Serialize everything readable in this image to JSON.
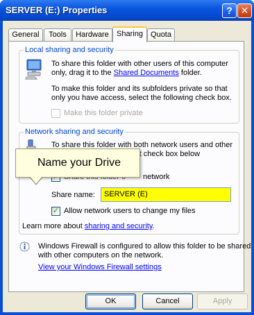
{
  "window": {
    "title": "SERVER (E:) Properties",
    "help_glyph": "?",
    "close_glyph": "✕"
  },
  "tabs": [
    {
      "label": "General"
    },
    {
      "label": "Tools"
    },
    {
      "label": "Hardware"
    },
    {
      "label": "Sharing",
      "active": true
    },
    {
      "label": "Quota"
    }
  ],
  "local_sharing": {
    "legend": "Local sharing and security",
    "line1": "To share this folder with other users of this computer",
    "line2_prefix": "only, drag it to the ",
    "shared_documents_link": "Shared Documents",
    "line2_suffix": " folder.",
    "line3": "To make this folder and its subfolders private so that",
    "line4": "only you have access, select the following check box.",
    "make_private_label": "Make this folder private",
    "make_private_checked": false,
    "make_private_enabled": false
  },
  "network_sharing": {
    "legend": "Network sharing and security",
    "line1": "To share this folder with both network users and other",
    "line2": "ct the first check box below",
    "share_checkbox_label": "network",
    "share_checkbox_label_partial": "Share this folder o",
    "share_checked": true,
    "share_name_label": "Share name:",
    "share_name_value": "SERVER (E)",
    "allow_change_label": "Allow network users to change my files",
    "allow_change_checked": true,
    "learn_more_prefix": "Learn more about ",
    "learn_more_link": "sharing and security",
    "learn_more_suffix": "."
  },
  "callout": {
    "text": "Name your Drive"
  },
  "firewall": {
    "line1": "Windows Firewall is configured to allow this folder to be shared",
    "line2": "with other computers on the network.",
    "settings_link": "View your Windows Firewall settings"
  },
  "buttons": {
    "ok": "OK",
    "cancel": "Cancel",
    "apply": "Apply"
  },
  "colors": {
    "title_bar": "#0a56e0",
    "highlight_input": "#ffff00",
    "legend_text": "#0046d5",
    "link": "#0000ff",
    "callout_bg": "#ffffe0"
  },
  "icons": [
    "computer-icon",
    "network-share-icon",
    "info-icon",
    "help-icon",
    "close-icon"
  ]
}
